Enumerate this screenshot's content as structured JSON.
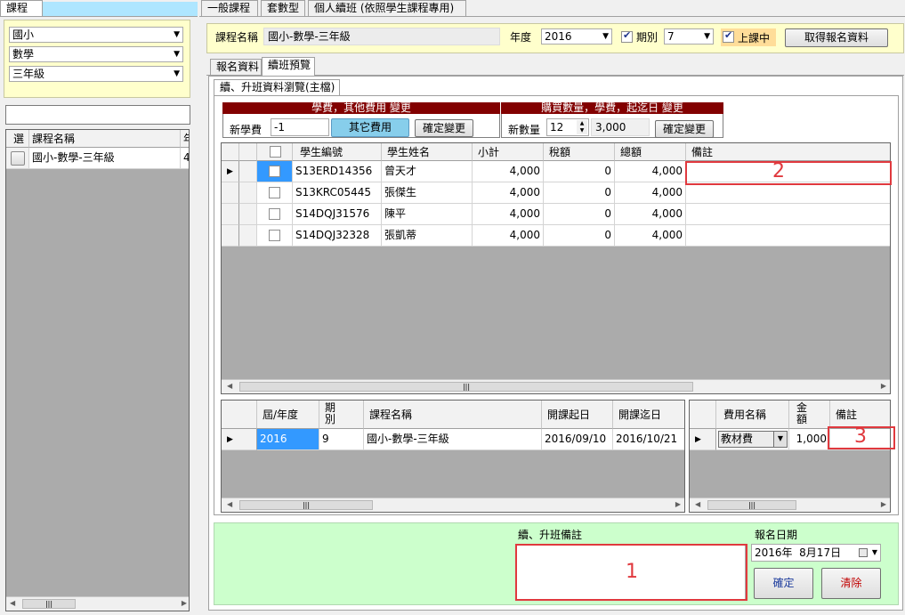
{
  "left_tab": "課程",
  "left_filters": [
    {
      "value": "國小"
    },
    {
      "value": "數學"
    },
    {
      "value": "三年級"
    }
  ],
  "left_search_value": "",
  "left_grid": {
    "headers": [
      "選",
      "課程名稱",
      "年"
    ],
    "rows": [
      {
        "name": "國小-數學-三年級",
        "extra": "4"
      }
    ]
  },
  "top_tabs": [
    "一般課程",
    "套數型",
    "個人續班 (依照學生課程專用)"
  ],
  "course_bar": {
    "course_label": "課程名稱",
    "course_value": "國小-數學-三年級",
    "year_label": "年度",
    "year_value": "2016",
    "period_label": "期別",
    "period_value": "7",
    "in_class_label": "上課中",
    "fetch_button": "取得報名資料"
  },
  "sub_tabs": [
    "報名資料",
    "續班預覽"
  ],
  "section_tab": "續、升班資料瀏覽(主檔)",
  "fee_panel": {
    "header": "學費，其他費用 變更",
    "new_fee_label": "新學費",
    "new_fee_value": "-1",
    "other_fee_button": "其它費用",
    "confirm_button": "確定變更"
  },
  "qty_panel": {
    "header": "購買數量，學費，起迄日 變更",
    "new_qty_label": "新數量",
    "new_qty_value": "12",
    "amount_value": "3,000",
    "confirm_button": "確定變更"
  },
  "main_grid": {
    "headers": [
      "學生編號",
      "學生姓名",
      "小計",
      "稅額",
      "總額",
      "備註"
    ],
    "rows": [
      {
        "id": "S13ERD14356",
        "name": "曾天才",
        "subtotal": "4,000",
        "tax": "0",
        "total": "4,000",
        "note": ""
      },
      {
        "id": "S13KRC05445",
        "name": "張傑生",
        "subtotal": "4,000",
        "tax": "0",
        "total": "4,000",
        "note": ""
      },
      {
        "id": "S14DQJ31576",
        "name": "陳平",
        "subtotal": "4,000",
        "tax": "0",
        "total": "4,000",
        "note": ""
      },
      {
        "id": "S14DQJ32328",
        "name": "張凱蒂",
        "subtotal": "4,000",
        "tax": "0",
        "total": "4,000",
        "note": ""
      }
    ]
  },
  "period_grid": {
    "headers": [
      "屆/年度",
      "期別",
      "課程名稱",
      "開課起日",
      "開課迄日"
    ],
    "rows": [
      {
        "year": "2016",
        "period": "9",
        "course": "國小-數學-三年級",
        "start": "2016/09/10",
        "end": "2016/10/21"
      }
    ]
  },
  "fee_grid": {
    "headers": [
      "費用名稱",
      "金額",
      "備註"
    ],
    "rows": [
      {
        "name": "教材費",
        "amount": "1,000",
        "note": ""
      }
    ]
  },
  "bottom": {
    "note_label": "續、升班備註",
    "note_value": "",
    "date_label": "報名日期",
    "date_value": "2016年  8月17日",
    "ok_button": "確定",
    "clear_button": "清除"
  },
  "annotations": [
    "1",
    "2",
    "3"
  ],
  "colors": {
    "annotation": "#e0393e",
    "panel_green": "#ccffcc",
    "panel_yellow": "#ffffcc",
    "header_red": "#820000",
    "button_blue": "#87ceeb",
    "selection": "#3399ff"
  }
}
